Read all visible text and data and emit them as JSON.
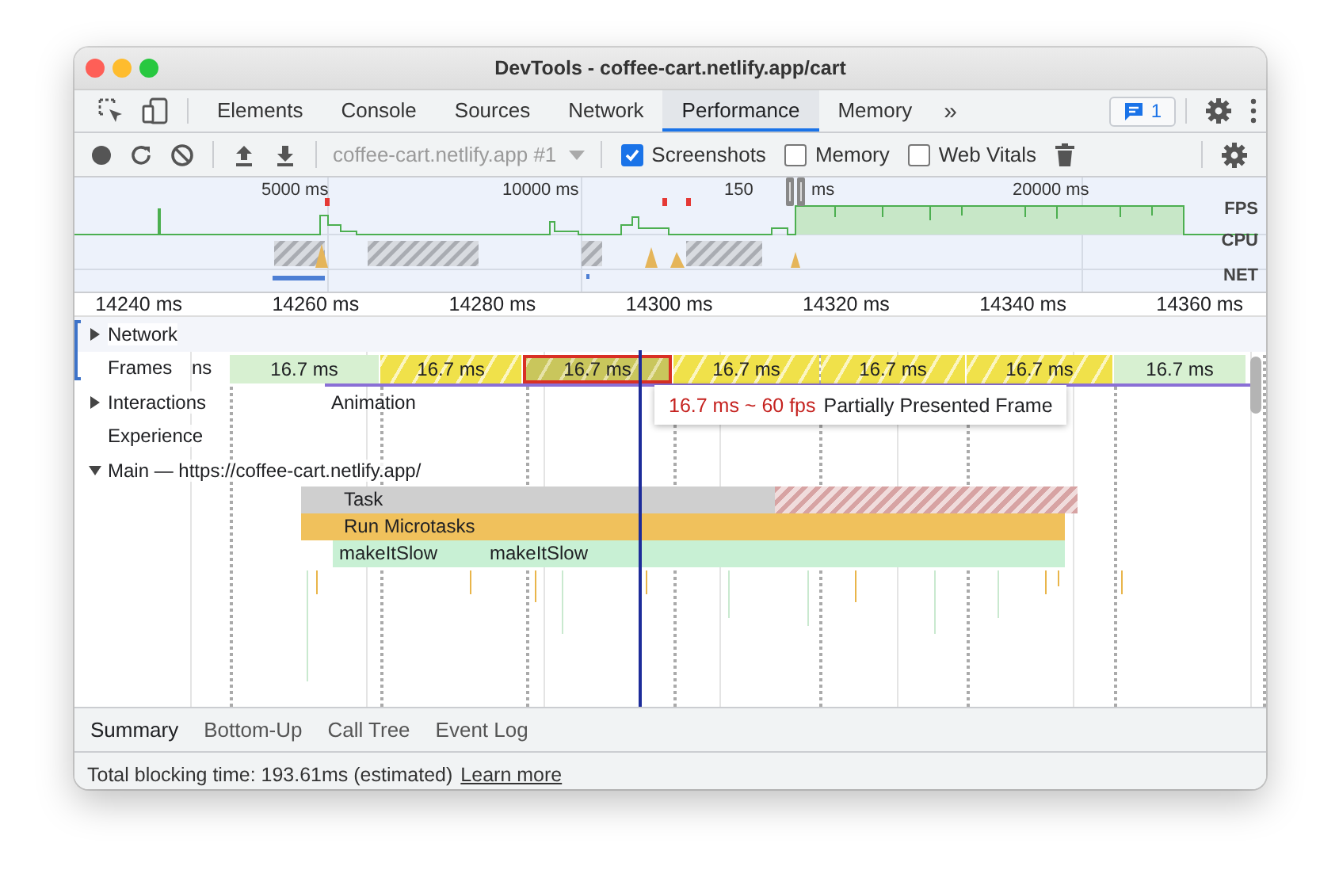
{
  "window": {
    "title": "DevTools - coffee-cart.netlify.app/cart"
  },
  "tabs": [
    {
      "label": "Elements",
      "selected": false
    },
    {
      "label": "Console",
      "selected": false
    },
    {
      "label": "Sources",
      "selected": false
    },
    {
      "label": "Network",
      "selected": false
    },
    {
      "label": "Performance",
      "selected": true
    },
    {
      "label": "Memory",
      "selected": false
    }
  ],
  "more_tabs": "»",
  "issues_badge": "1",
  "toolbar": {
    "profile_select": "coffee-cart.netlify.app #1",
    "checkboxes": [
      {
        "label": "Screenshots",
        "checked": true
      },
      {
        "label": "Memory",
        "checked": false
      },
      {
        "label": "Web Vitals",
        "checked": false
      }
    ]
  },
  "overview": {
    "tick_labels": [
      "5000 ms",
      "10000 ms",
      "150",
      "ms",
      "20000 ms"
    ],
    "lanes": [
      "FPS",
      "CPU",
      "NET"
    ]
  },
  "ruler": [
    "14240 ms",
    "14260 ms",
    "14280 ms",
    "14300 ms",
    "14320 ms",
    "14340 ms",
    "14360 ms"
  ],
  "tracks": [
    {
      "name": "Network",
      "kind": "collapsible",
      "expanded": false
    },
    {
      "name": "Frames",
      "kind": "frames",
      "overflow_text": "ns"
    },
    {
      "name": "Interactions",
      "kind": "collapsible",
      "expanded": false,
      "marker": "Animation"
    },
    {
      "name": "Experience",
      "kind": "plain"
    },
    {
      "name": "Main — https://coffee-cart.netlify.app/",
      "kind": "collapsible",
      "expanded": true
    }
  ],
  "frames": [
    {
      "label": "16.7 ms",
      "kind": "full",
      "selected": false
    },
    {
      "label": "16.7 ms",
      "kind": "partial",
      "selected": false
    },
    {
      "label": "16.7 ms",
      "kind": "partial",
      "selected": true
    },
    {
      "label": "16.7 ms",
      "kind": "partial",
      "selected": false
    },
    {
      "label": "16.7 ms",
      "kind": "partial",
      "selected": false
    },
    {
      "label": "16.7 ms",
      "kind": "partial",
      "selected": false
    },
    {
      "label": "16.7 ms",
      "kind": "full",
      "selected": false
    }
  ],
  "tooltip": {
    "timing": "16.7 ms ~ 60 fps",
    "description": "Partially Presented Frame"
  },
  "flame": [
    {
      "label": "Task",
      "kind": "task"
    },
    {
      "label": "Run Microtasks",
      "kind": "microtasks"
    },
    {
      "label": "makeItSlow",
      "kind": "function"
    },
    {
      "label": "makeItSlow",
      "kind": "function"
    }
  ],
  "bottom_tabs": [
    {
      "label": "Summary",
      "selected": true
    },
    {
      "label": "Bottom-Up",
      "selected": false
    },
    {
      "label": "Call Tree",
      "selected": false
    },
    {
      "label": "Event Log",
      "selected": false
    }
  ],
  "status": {
    "text": "Total blocking time: 193.61ms (estimated)",
    "link": "Learn more"
  }
}
